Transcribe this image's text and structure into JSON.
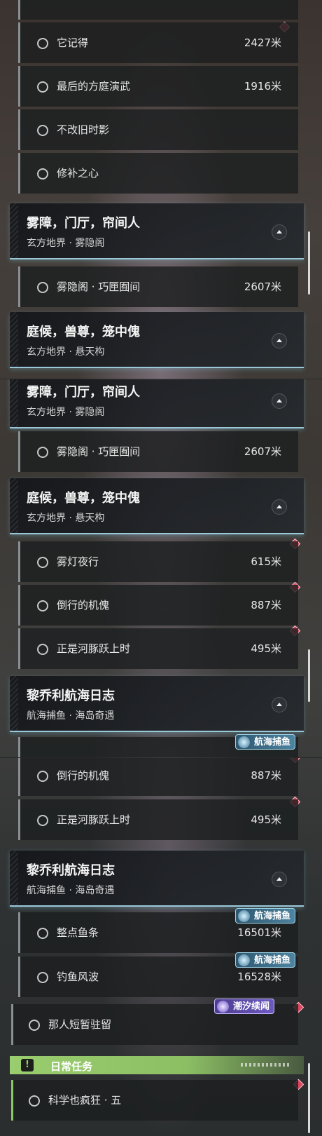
{
  "panel1": {
    "tasks_top": [
      {
        "name": "它记得",
        "distance": "2427米"
      },
      {
        "name": "最后的方庭演武",
        "distance": "1916米"
      },
      {
        "name": "不改旧时影",
        "distance": ""
      },
      {
        "name": "修补之心",
        "distance": ""
      }
    ],
    "group_mist": {
      "title": "雾障，门厅，帘间人",
      "subtitle": "玄方地界 · 雾隐阁"
    },
    "task_mist": {
      "name": "雾隐阁 · 巧匣囿间",
      "distance": "2607米"
    },
    "group_court": {
      "title": "庭候，兽尊，笼中傀",
      "subtitle": "玄方地界 · 悬天构"
    }
  },
  "panel2": {
    "group_mist": {
      "title": "雾障，门厅，帘间人",
      "subtitle": "玄方地界 · 雾隐阁"
    },
    "task_mist": {
      "name": "雾隐阁 · 巧匣囿间",
      "distance": "2607米"
    },
    "group_court": {
      "title": "庭候，兽尊，笼中傀",
      "subtitle": "玄方地界 · 悬天构"
    },
    "tasks_court": [
      {
        "name": "雾灯夜行",
        "distance": "615米"
      },
      {
        "name": "倒行的机傀",
        "distance": "887米"
      },
      {
        "name": "正是河豚跃上时",
        "distance": "495米"
      }
    ],
    "group_log": {
      "title": "黎乔利航海日志",
      "subtitle": "航海捕鱼 · 海岛奇遇"
    },
    "badge_fish": "航海捕鱼"
  },
  "panel3": {
    "tasks_court": [
      {
        "name": "倒行的机傀",
        "distance": "887米"
      },
      {
        "name": "正是河豚跃上时",
        "distance": "495米"
      }
    ],
    "group_log": {
      "title": "黎乔利航海日志",
      "subtitle": "航海捕鱼 · 海岛奇遇"
    },
    "tasks_log": [
      {
        "name": "整点鱼条",
        "distance": "16501米",
        "badge": "航海捕鱼"
      },
      {
        "name": "钓鱼风波",
        "distance": "16528米",
        "badge": "航海捕鱼"
      }
    ],
    "task_stay": {
      "name": "那人短暂驻留",
      "badge": "潮汐续闻"
    },
    "daily": {
      "icon": "!",
      "label": "日常任务"
    },
    "task_science": {
      "name": "科学也疯狂 · 五"
    }
  },
  "colors": {
    "accent_cyan": "#9bc8d8",
    "tracked_marker": "#d94860",
    "daily_green": "#9acd6e",
    "badge_fish": "#4d84a0",
    "badge_tide": "#6c5ac0"
  },
  "icons": {
    "task_status": "circle-outline-icon",
    "tracked_marker": "diamond-icon",
    "collapse": "chevron-up-icon",
    "daily": "exclamation-icon"
  }
}
